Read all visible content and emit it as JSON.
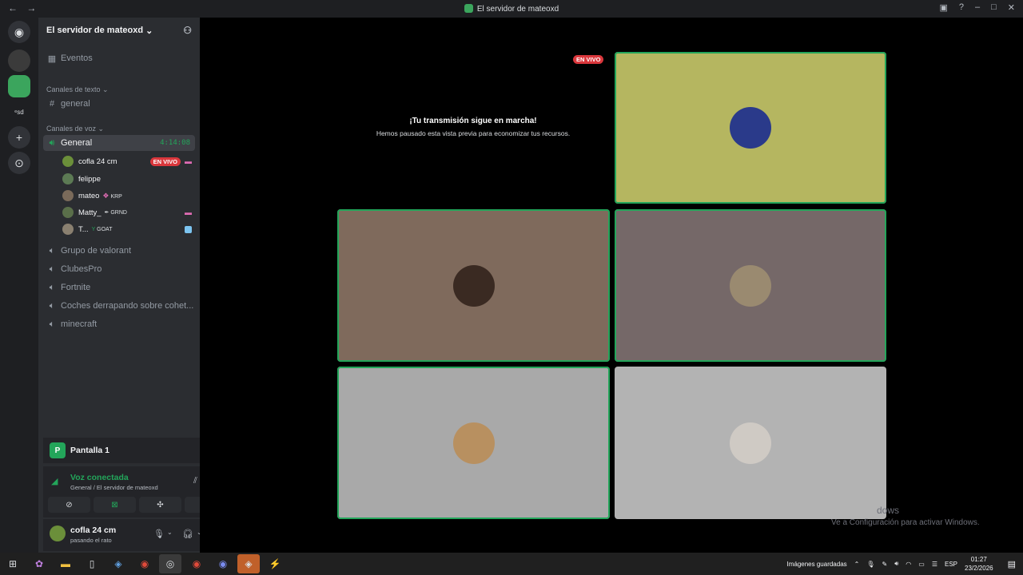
{
  "window": {
    "title": "El servidor de mateoxd",
    "back": "←",
    "forward": "→"
  },
  "sidebar": {
    "server_name": "El servidor de mateoxd",
    "events_label": "Eventos",
    "text_category": "Canales de texto",
    "text_channels": [
      "general"
    ],
    "voice_category": "Canales de voz",
    "active_channel": {
      "name": "General",
      "time": "4:14:08"
    },
    "members": [
      {
        "name": "cofla 24 cm",
        "tag": "",
        "live": "EN VIVO",
        "color": "#6b8f3a"
      },
      {
        "name": "felippe",
        "tag": "",
        "live": "",
        "color": "#5c7a54"
      },
      {
        "name": "mateo",
        "tag": "KRP",
        "live": "",
        "color": "#7a6a5a"
      },
      {
        "name": "Matty_",
        "tag": "GRND",
        "live": "",
        "color": "#5a6f4a"
      },
      {
        "name": "T...",
        "tag": "GOAT",
        "live": "",
        "color": "#8a8070"
      }
    ],
    "voice_channels": [
      "Grupo de valorant",
      "ClubesPro",
      "Fortnite",
      "Coches derrapando sobre cohet...",
      "minecraft"
    ]
  },
  "stream_panel": {
    "title": "Pantalla 1"
  },
  "voice_panel": {
    "status": "Voz conectada",
    "sub": "General / El servidor de mateoxd"
  },
  "user_panel": {
    "name": "cofla 24 cm",
    "status": "pasando el rato"
  },
  "stage": {
    "paused_title": "¡Tu transmisión sigue en marcha!",
    "paused_sub": "Hemos pausado esta vista previa para economizar tus recursos.",
    "live_badge": "EN VIVO",
    "tiles": [
      {
        "bg": "#b5b660",
        "avatar": "#2a3a8a"
      },
      {
        "bg": "#7f6a5c",
        "avatar": "#3a2a22"
      },
      {
        "bg": "#756868",
        "avatar": "#9a8a70"
      },
      {
        "bg": "#a9a9a9",
        "avatar": "#b89060"
      },
      {
        "bg": "#b3b3b3",
        "avatar": "#cfcac4"
      }
    ]
  },
  "watermark": {
    "line1": "dows",
    "line2": "Ve a Configuración para activar Windows."
  },
  "taskbar": {
    "saved": "Imágenes guardadas",
    "lang": "ESP",
    "time": "01:27",
    "date": "23/2/2026"
  }
}
